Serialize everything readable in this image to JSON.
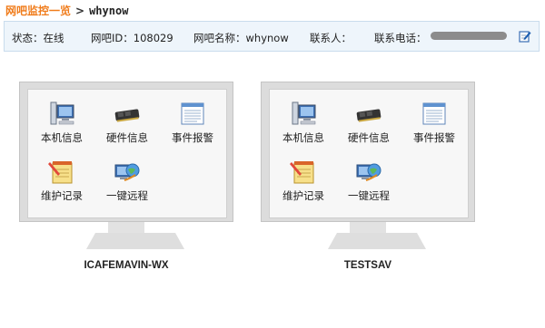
{
  "breadcrumb": {
    "root": "网吧监控一览",
    "separator": ">",
    "current": "whynow"
  },
  "info": {
    "status_label": "状态：",
    "status_value": "在线",
    "id_label": "网吧ID：",
    "id_value": "108029",
    "name_label": "网吧名称：",
    "name_value": "whynow",
    "contact_label": "联系人：",
    "contact_value": "",
    "phone_label": "联系电话：",
    "phone_value": ""
  },
  "apps": {
    "local_info": "本机信息",
    "hardware_info": "硬件信息",
    "event_alarm": "事件报警",
    "maintenance_log": "维护记录",
    "remote": "一键远程"
  },
  "computers": [
    {
      "name": "ICAFEMAVIN-WX"
    },
    {
      "name": "TESTSAV"
    }
  ],
  "colors": {
    "breadcrumb_root": "#f07c1b",
    "infobar_bg": "#eef5fb",
    "monitor_frame": "#dcdcdc"
  }
}
